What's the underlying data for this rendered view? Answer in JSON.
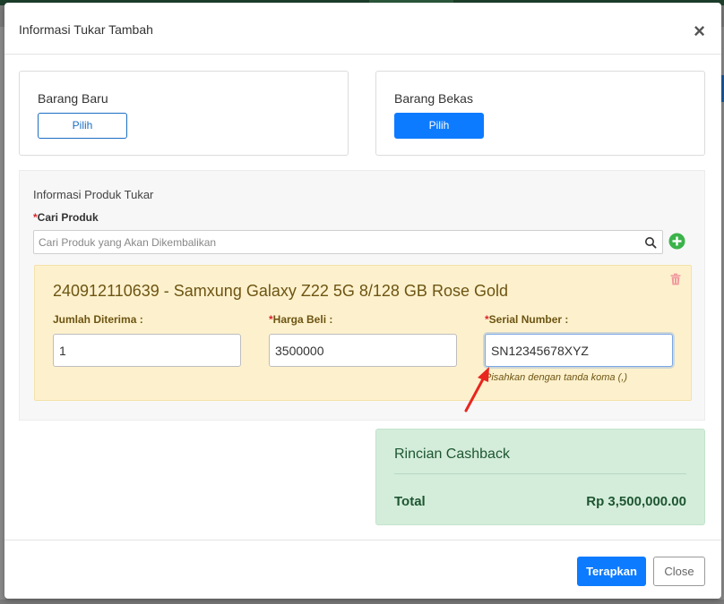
{
  "modal": {
    "title": "Informasi Tukar Tambah",
    "close_symbol": "×"
  },
  "barang_baru": {
    "label": "Barang Baru",
    "button": "Pilih"
  },
  "barang_bekas": {
    "label": "Barang Bekas",
    "button": "Pilih"
  },
  "produk_tukar": {
    "title": "Informasi Produk Tukar",
    "search_label": "Cari Produk",
    "search_placeholder": "Cari Produk yang Akan Dikembalikan",
    "required_mark": "*"
  },
  "product": {
    "title": "240912110639 - Samxung Galaxy Z22 5G 8/128 GB Rose Gold",
    "fields": {
      "jumlah_label": "Jumlah Diterima :",
      "jumlah_value": "1",
      "harga_label": "Harga Beli :",
      "harga_value": "3500000",
      "serial_label": "Serial Number :",
      "serial_value": "SN12345678XYZ"
    },
    "hint": "Pisahkan dengan tanda koma (,)"
  },
  "cashback": {
    "title": "Rincian Cashback",
    "total_label": "Total",
    "total_value": "Rp 3,500,000.00"
  },
  "footer": {
    "apply": "Terapkan",
    "close": "Close"
  },
  "colors": {
    "primary": "#0d7bff",
    "product_bg": "#fdf1cd",
    "cashback_bg": "#d4eddb",
    "required": "#d9262c",
    "add_icon": "#3bb34a",
    "trash_icon": "#f19aa0",
    "arrow": "#e8261e"
  }
}
